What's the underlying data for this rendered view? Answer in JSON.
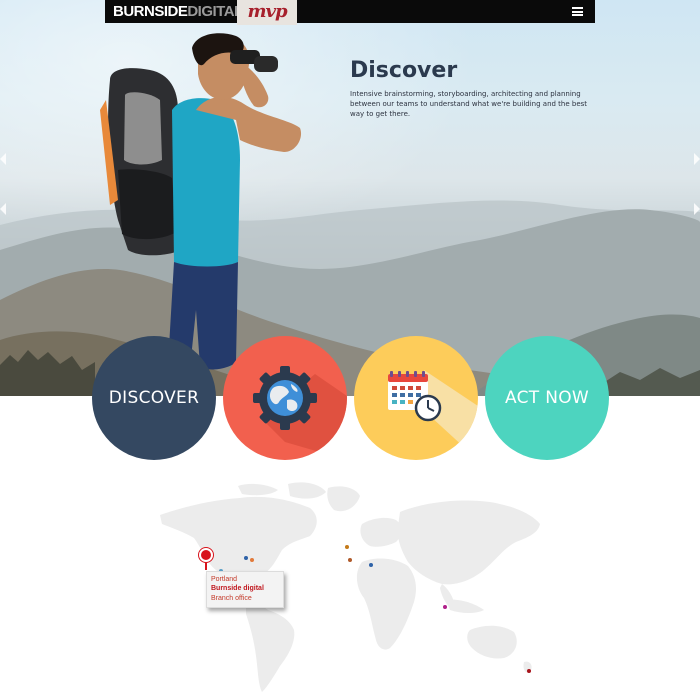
{
  "header": {
    "logo_bold": "BURNSIDE",
    "logo_light": "DIGITAL",
    "brand_mark": "mvp",
    "menu_icon": "hamburger-icon"
  },
  "hero": {
    "title": "Discover",
    "description": "Intensive brainstorming, storyboarding, architecting and planning between our teams to understand what we're building and the best way to get there.",
    "left_arrow_icon": "chevron-left-icon",
    "right_arrow_icon": "chevron-right-icon"
  },
  "circles": [
    {
      "label": "DISCOVER",
      "color": "#344861"
    },
    {
      "icon": "globe-gear-icon",
      "color": "#f2604e"
    },
    {
      "icon": "calendar-clock-icon",
      "color": "#fdcc5a"
    },
    {
      "label": "ACT NOW",
      "color": "#4dd4bf"
    }
  ],
  "map": {
    "tooltip": {
      "city": "Portland",
      "company": "Burnside digital",
      "office": "Branch office"
    },
    "pin_color": "#d8141c"
  }
}
